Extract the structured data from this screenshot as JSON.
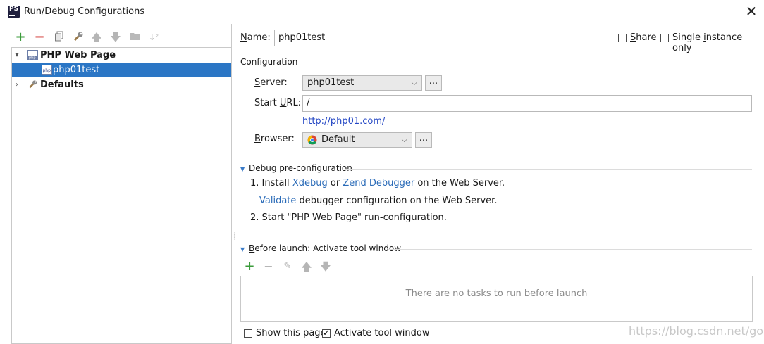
{
  "window": {
    "title": "Run/Debug Configurations",
    "app_icon_text": "PS",
    "close_glyph": "✕"
  },
  "left_toolbar": {
    "icons": [
      "add-icon",
      "remove-icon",
      "copy-icon",
      "edit-defaults-icon",
      "move-up-icon",
      "move-down-icon",
      "folder-icon",
      "sort-icon"
    ]
  },
  "tree": {
    "items": [
      {
        "label": "PHP Web Page",
        "expanded": true,
        "bold": true,
        "icon": "php-web-page-icon"
      },
      {
        "label": "php01test",
        "selected": true,
        "icon": "php-config-icon"
      },
      {
        "label": "Defaults",
        "expanded": false,
        "bold": true,
        "icon": "wrench-icon"
      }
    ]
  },
  "form": {
    "name_label_u": "N",
    "name_label_rest": "ame:",
    "name_value": "php01test",
    "share_label_u": "S",
    "share_label_rest": "hare",
    "share_checked": false,
    "single_label_pre": "Single ",
    "single_label_u": "i",
    "single_label_rest": "nstance only",
    "single_checked": false
  },
  "configuration": {
    "heading": "Configuration",
    "server_label_u": "S",
    "server_label_rest": "erver:",
    "server_value": "php01test",
    "start_url_label_pre": "Start ",
    "start_url_label_u": "U",
    "start_url_label_rest": "RL:",
    "start_url_value": "/",
    "resolved_url": "http://php01.com/",
    "browser_label_u": "B",
    "browser_label_rest": "rowser:",
    "browser_value": "Default",
    "browser_icon": "chrome-icon",
    "ellipsis": "..."
  },
  "debug": {
    "heading": "Debug pre-configuration",
    "step1_prefix": "1. Install",
    "xdebug_link": "Xdebug",
    "or_text": "or",
    "zend_link": "Zend Debugger",
    "step1_suffix": "on the Web Server.",
    "validate_link": "Validate",
    "validate_suffix": "debugger configuration on the Web Server.",
    "step2": "2. Start \"PHP Web Page\" run-configuration."
  },
  "before_launch": {
    "heading_u": "B",
    "heading_rest": "efore launch: Activate tool window",
    "toolbar_icons": [
      "add-icon",
      "remove-icon",
      "edit-icon",
      "move-up-icon",
      "move-down-icon"
    ],
    "empty_message": "There are no tasks to run before launch",
    "show_page_label": "Show this page",
    "show_page_checked": false,
    "activate_label": "Activate tool window",
    "activate_checked": true
  },
  "watermark": "https://blog.csdn.net/gorch",
  "colors": {
    "selection": "#2b76c5",
    "link": "#2a6bb8",
    "add_green": "#3b9b3b",
    "remove_red": "#d9534f"
  }
}
